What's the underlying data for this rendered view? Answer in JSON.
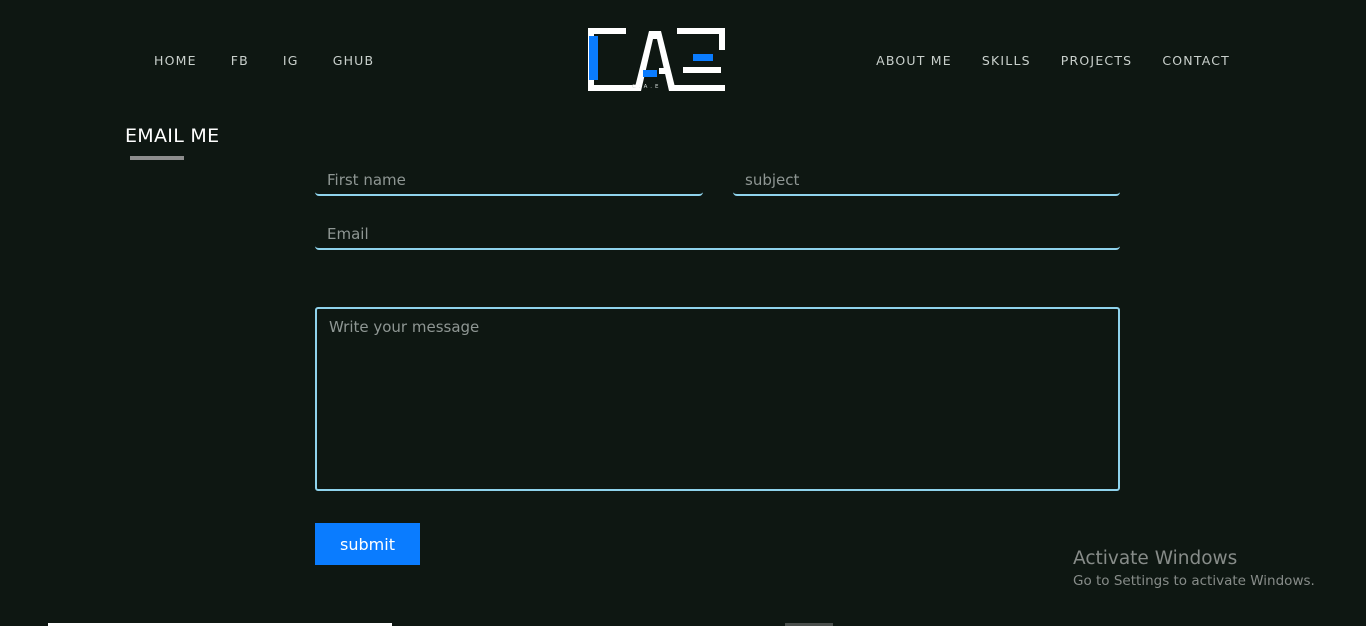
{
  "nav": {
    "left": [
      {
        "label": "HOME"
      },
      {
        "label": "FB"
      },
      {
        "label": "IG"
      },
      {
        "label": "GHUB"
      }
    ],
    "right": [
      {
        "label": "ABOUT ME"
      },
      {
        "label": "SKILLS"
      },
      {
        "label": "PROJECTS"
      },
      {
        "label": "CONTACT"
      }
    ]
  },
  "logo": {
    "text": "CAE",
    "subtext": "C.A.E",
    "colors": {
      "primary": "#ffffff",
      "accent": "#0a7cff"
    }
  },
  "section": {
    "title": "EMAIL ME"
  },
  "form": {
    "first_name_placeholder": "First name",
    "subject_placeholder": "subject",
    "email_placeholder": "Email",
    "message_placeholder": "Write your message",
    "submit_label": "submit"
  },
  "watermark": {
    "title": "Activate Windows",
    "subtitle": "Go to Settings to activate Windows."
  },
  "colors": {
    "background": "#0e1712",
    "input_border": "#8fd3ec",
    "button": "#0a7cff"
  }
}
